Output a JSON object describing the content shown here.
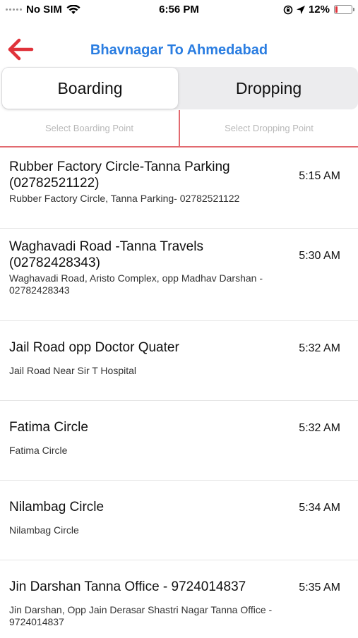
{
  "status_bar": {
    "carrier": "No SIM",
    "time": "6:56 PM",
    "battery_percent": "12%",
    "battery_level": 0.12
  },
  "header": {
    "title": "Bhavnagar To Ahmedabad",
    "back_icon": "arrow-left-icon",
    "accent_color": "#2a7de1",
    "back_color": "#e0323a"
  },
  "tabs": [
    {
      "label": "Boarding",
      "active": true
    },
    {
      "label": "Dropping",
      "active": false
    }
  ],
  "selectors": {
    "boarding_placeholder": "Select Boarding Point",
    "dropping_placeholder": "Select Dropping Point"
  },
  "points": [
    {
      "name": "Rubber Factory Circle-Tanna Parking (02782521122)",
      "address": "Rubber Factory Circle, Tanna Parking- 02782521122",
      "time": "5:15 AM"
    },
    {
      "name": "Waghavadi Road -Tanna Travels (02782428343)",
      "address": "Waghavadi Road, Aristo Complex, opp Madhav Darshan - 02782428343",
      "time": "5:30 AM"
    },
    {
      "name": "Jail Road opp Doctor Quater",
      "address": " Jail Road Near Sir T Hospital",
      "time": "5:32 AM"
    },
    {
      "name": "Fatima Circle",
      "address": "Fatima Circle",
      "time": "5:32 AM"
    },
    {
      "name": "Nilambag Circle",
      "address": "Nilambag Circle",
      "time": "5:34 AM"
    },
    {
      "name": "Jin Darshan Tanna Office - 9724014837",
      "address": "Jin Darshan, Opp Jain Derasar Shastri Nagar Tanna Office - 9724014837",
      "time": "5:35 AM"
    }
  ]
}
